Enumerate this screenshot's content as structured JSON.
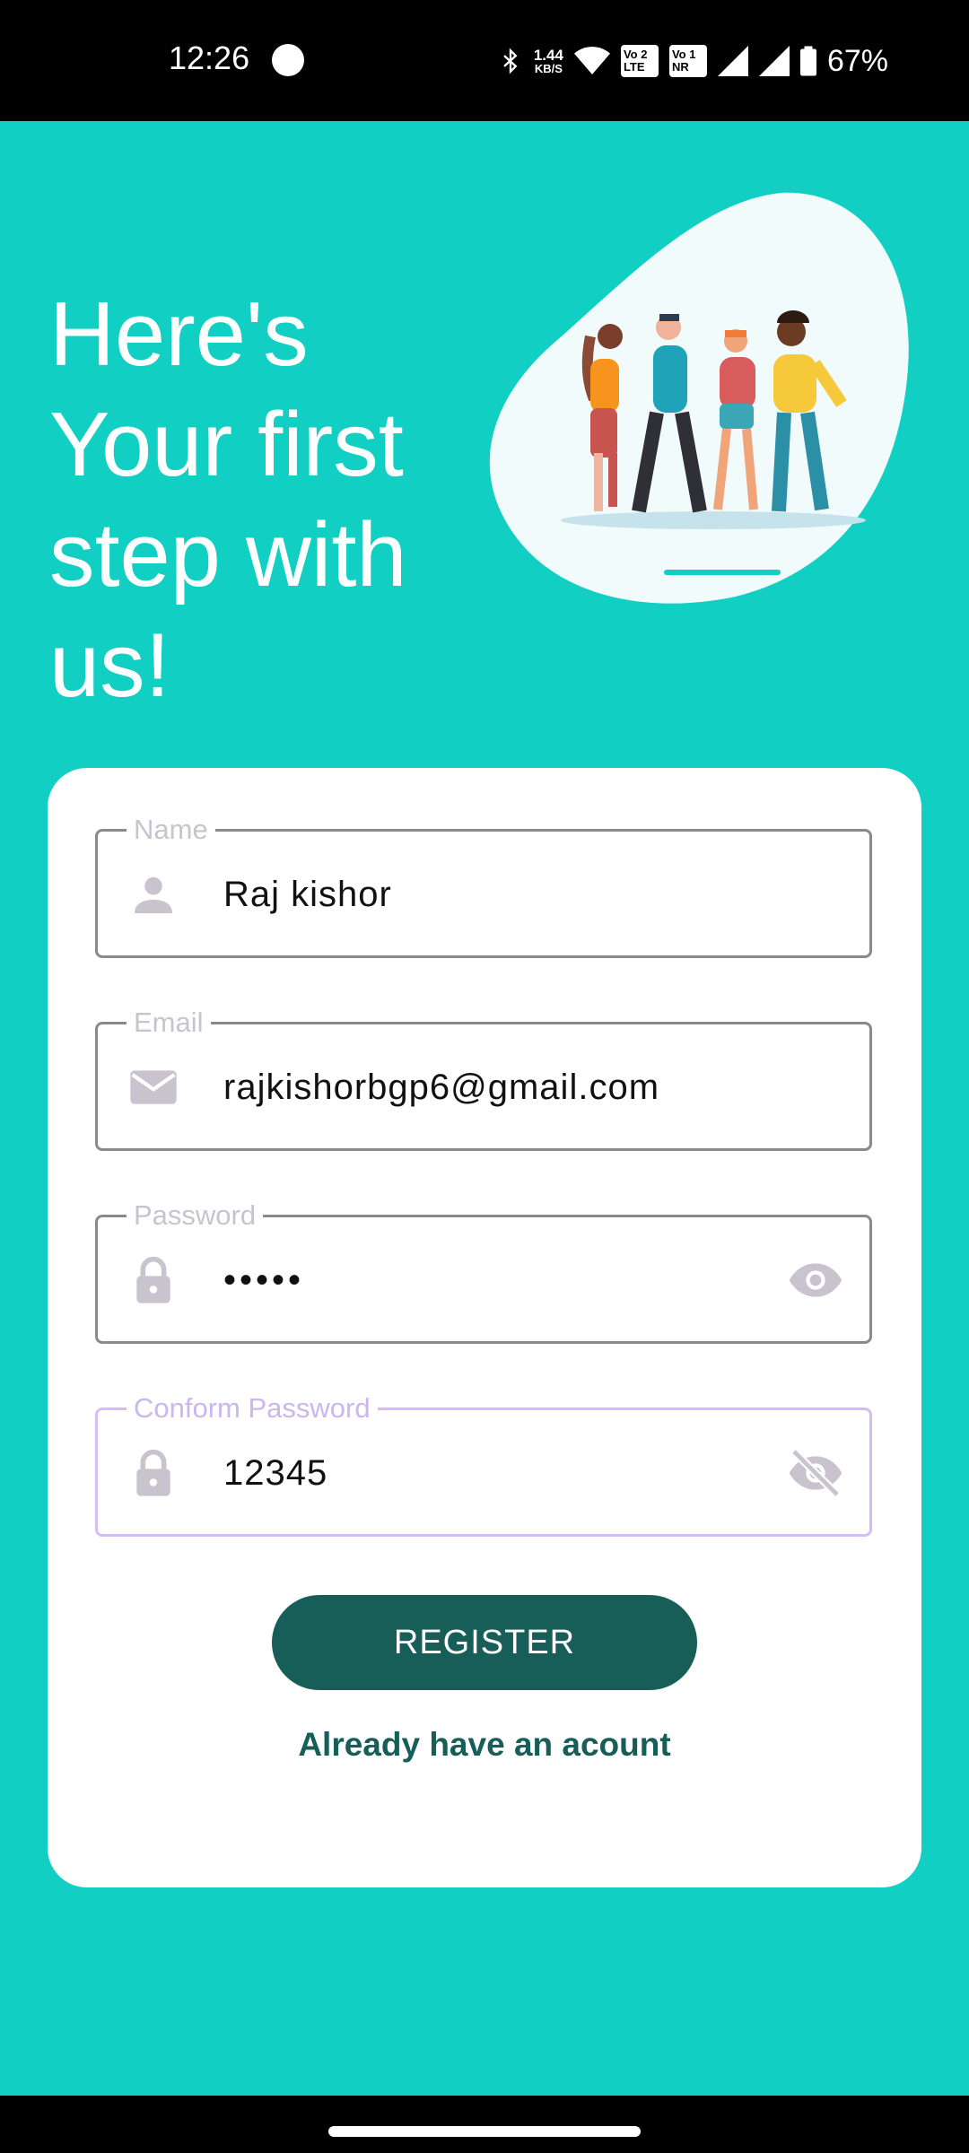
{
  "status_bar": {
    "time": "12:26",
    "net_speed": "1.44",
    "net_unit": "KB/S",
    "sim1": "Vo 2 LTE",
    "sim2": "Vo 1 NR",
    "battery": "67%"
  },
  "headline": "Here's Your first step with us!",
  "form": {
    "name": {
      "label": "Name",
      "value": "Raj kishor",
      "icon": "person-icon"
    },
    "email": {
      "label": "Email",
      "value": "rajkishorbgp6@gmail.com",
      "icon": "mail-icon"
    },
    "password": {
      "label": "Password",
      "value": "•••••",
      "icon": "lock-icon",
      "toggle": "eye-icon"
    },
    "confirm_password": {
      "label": "Conform Password",
      "value": "12345",
      "icon": "lock-icon",
      "toggle": "eye-off-icon"
    },
    "register_label": "REGISTER",
    "login_link": "Already have an acount"
  },
  "colors": {
    "background": "#12CFC4",
    "primary": "#175E58",
    "focus": "#D5BCF7"
  }
}
